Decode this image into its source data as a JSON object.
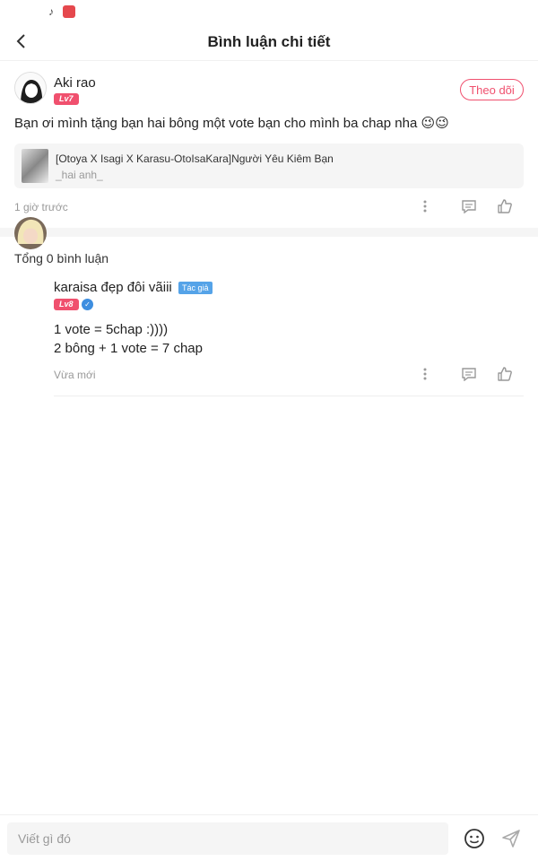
{
  "header": {
    "title": "Bình luận chi tiết"
  },
  "post": {
    "username": "Aki rao",
    "level": "Lv7",
    "follow_label": "Theo dõi",
    "text": "Bạn ơi mình tặng bạn hai bông một vote bạn cho mình ba chap nha 😉😉",
    "story": {
      "title": "[Otoya X Isagi X Karasu-OtoIsaKara]Người Yêu Kiêm Bạn",
      "author": "_hai anh_"
    },
    "time": "1 giờ trước"
  },
  "comments": {
    "total_label": "Tổng 0 bình luận",
    "items": [
      {
        "username": "karaisa đẹp đôi vãiii",
        "author_tag": "Tác giả",
        "level": "Lv8",
        "lines": [
          "1 vote = 5chap :))))",
          "2 bông + 1 vote = 7 chap"
        ],
        "time": "Vừa mới"
      }
    ]
  },
  "composer": {
    "placeholder": "Viết gì đó"
  },
  "colors": {
    "accent": "#f0506e",
    "author_tag": "#55a3e8",
    "muted": "#999999"
  }
}
